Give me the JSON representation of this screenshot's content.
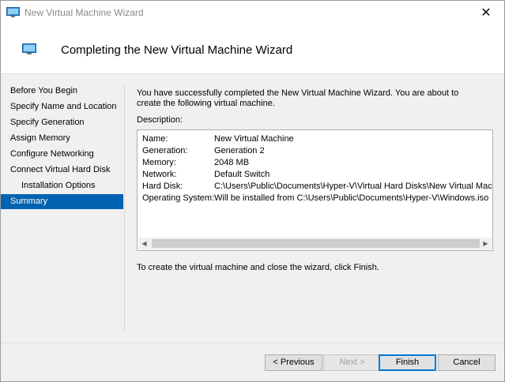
{
  "window": {
    "title": "New Virtual Machine Wizard",
    "close_glyph": "✕",
    "icon": "vm-monitor-icon"
  },
  "header": {
    "title": "Completing the New Virtual Machine Wizard",
    "icon": "vm-monitor-icon"
  },
  "nav": {
    "items": [
      {
        "label": "Before You Begin"
      },
      {
        "label": "Specify Name and Location"
      },
      {
        "label": "Specify Generation"
      },
      {
        "label": "Assign Memory"
      },
      {
        "label": "Configure Networking"
      },
      {
        "label": "Connect Virtual Hard Disk"
      },
      {
        "label": "Installation Options"
      },
      {
        "label": "Summary"
      }
    ],
    "active_index": 7
  },
  "content": {
    "intro": "You have successfully completed the New Virtual Machine Wizard. You are about to create the following virtual machine.",
    "description_label": "Description:",
    "rows": [
      {
        "key": "Name:",
        "value": "New Virtual Machine"
      },
      {
        "key": "Generation:",
        "value": "Generation 2"
      },
      {
        "key": "Memory:",
        "value": "2048 MB"
      },
      {
        "key": "Network:",
        "value": "Default Switch"
      },
      {
        "key": "Hard Disk:",
        "value": "C:\\Users\\Public\\Documents\\Hyper-V\\Virtual Hard Disks\\New Virtual Machine.vhdx"
      },
      {
        "key": "Operating System:",
        "value": "Will be installed from C:\\Users\\Public\\Documents\\Hyper-V\\Windows.iso"
      }
    ],
    "scroll_left_glyph": "◀",
    "scroll_right_glyph": "▶",
    "finish_note": "To create the virtual machine and close the wizard, click Finish."
  },
  "buttons": {
    "previous": "< Previous",
    "next": "Next >",
    "finish": "Finish",
    "cancel": "Cancel"
  },
  "colors": {
    "accent": "#0063b1",
    "focus_border": "#0078d7"
  }
}
